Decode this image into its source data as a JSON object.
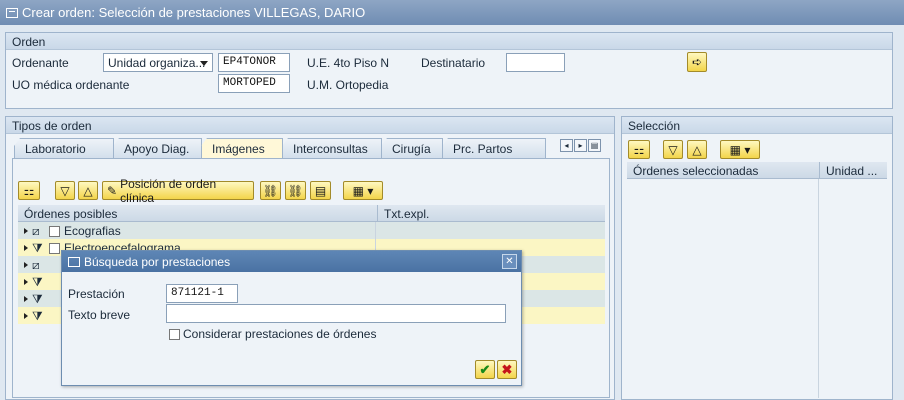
{
  "window": {
    "title": "Crear orden: Selección de prestaciones VILLEGAS, DARIO"
  },
  "orden": {
    "header": "Orden",
    "ordenante_label": "Ordenante",
    "ordenante_type": "Unidad organiza...",
    "ordenante_code": "EP4TONOR",
    "ordenante_desc": "U.E. 4to Piso N",
    "destinatario_label": "Destinatario",
    "destinatario_value": "",
    "uo_label": "UO médica ordenante",
    "uo_code": "MORTOPED",
    "uo_desc": "U.M. Ortopedia"
  },
  "tipos": {
    "header": "Tipos de orden",
    "tabs": [
      "Laboratorio",
      "Apoyo Diag.",
      "Imágenes",
      "Interconsultas",
      "Cirugía",
      "Prc. Partos"
    ],
    "active_tab": "Imágenes",
    "toolbar": {
      "posicion_label": "Posición de orden clínica"
    },
    "columns": [
      "Órdenes posibles",
      "Txt.expl."
    ],
    "rows": [
      {
        "label": "Ecografias"
      },
      {
        "label": "Electroencefalograma"
      }
    ]
  },
  "seleccion": {
    "header": "Selección",
    "columns": [
      "Órdenes seleccionadas",
      "Unidad ..."
    ]
  },
  "dialog": {
    "title": "Búsqueda por prestaciones",
    "prestacion_label": "Prestación",
    "prestacion_value": "871121-1",
    "texto_label": "Texto breve",
    "texto_value": "",
    "considerar_label": "Considerar prestaciones de órdenes"
  }
}
